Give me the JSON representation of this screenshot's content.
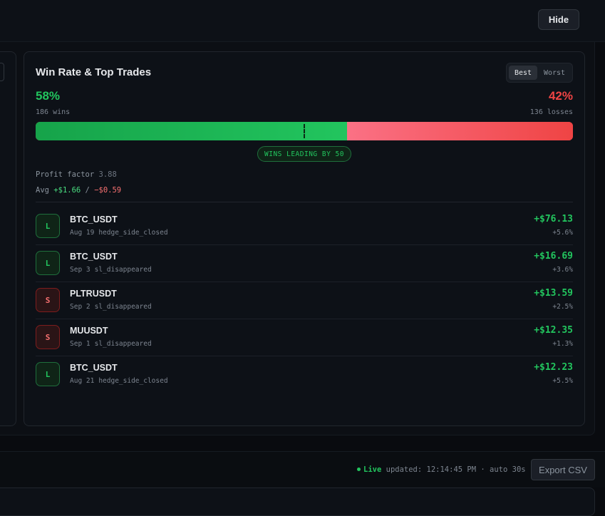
{
  "header": {
    "hide_label": "Hide"
  },
  "card": {
    "title": "Win Rate & Top Trades",
    "toggle": {
      "best": "Best",
      "worst": "Worst"
    },
    "win_pct_label": "58%",
    "loss_pct_label": "42%",
    "wins_label": "186 wins",
    "losses_label": "136 losses",
    "win_share": 0.58,
    "leading_label": "WINS LEADING BY 50",
    "profit_factor_label": "Profit factor",
    "profit_factor_value": "3.88",
    "avg_label": "Avg",
    "avg_win": "+$1.66",
    "avg_sep": " / ",
    "avg_loss": "−$0.59",
    "colors": {
      "win": "#22c55e",
      "loss": "#ef4444"
    }
  },
  "trades": [
    {
      "side": "L",
      "symbol": "BTC_USDT",
      "date": "Aug 19",
      "reason": "hedge_side_closed",
      "pnl": "+$76.13",
      "pct": "+5.6%"
    },
    {
      "side": "L",
      "symbol": "BTC_USDT",
      "date": "Sep 3",
      "reason": "sl_disappeared",
      "pnl": "+$16.69",
      "pct": "+3.6%"
    },
    {
      "side": "S",
      "symbol": "PLTRUSDT",
      "date": "Sep 2",
      "reason": "sl_disappeared",
      "pnl": "+$13.59",
      "pct": "+2.5%"
    },
    {
      "side": "S",
      "symbol": "MUUSDT",
      "date": "Sep 1",
      "reason": "sl_disappeared",
      "pnl": "+$12.35",
      "pct": "+1.3%"
    },
    {
      "side": "L",
      "symbol": "BTC_USDT",
      "date": "Aug 21",
      "reason": "hedge_side_closed",
      "pnl": "+$12.23",
      "pct": "+5.5%"
    }
  ],
  "footer": {
    "live_label": "Live",
    "updated_text": "updated: 12:14:45 PM · auto 30s",
    "export_label": "Export CSV"
  }
}
